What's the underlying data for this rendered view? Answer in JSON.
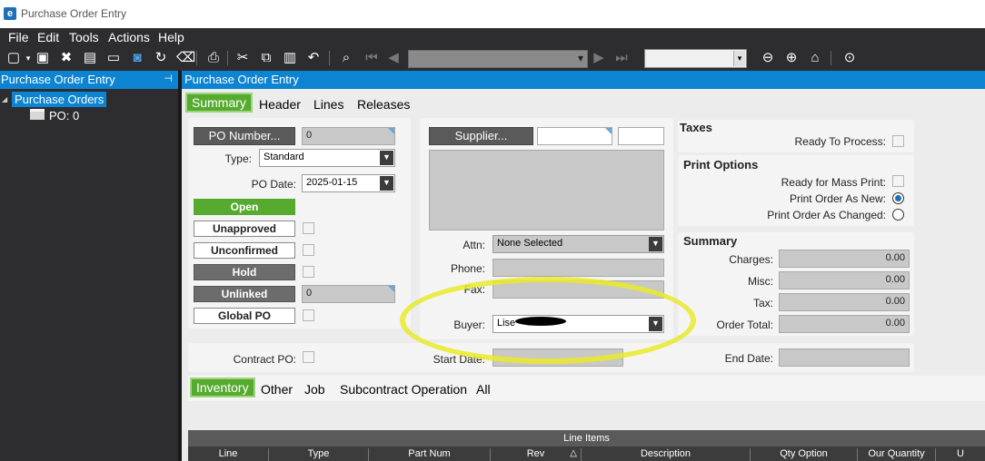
{
  "window": {
    "title": "Purchase Order Entry",
    "app_icon": "epicor-icon"
  },
  "menu": [
    "File",
    "Edit",
    "Tools",
    "Actions",
    "Help"
  ],
  "tree": {
    "header": "Purchase Order Entry",
    "root": "Purchase Orders",
    "child": "PO: 0"
  },
  "main": {
    "header": "Purchase Order Entry",
    "tabs": [
      "Summary",
      "Header",
      "Lines",
      "Releases"
    ],
    "po_number_button": "PO Number...",
    "po_number_value": "0",
    "type_label": "Type:",
    "type_value": "Standard",
    "po_date_label": "PO Date:",
    "po_date_value": "2025-01-15",
    "status": {
      "open": "Open",
      "unapproved": "Unapproved",
      "unconfirmed": "Unconfirmed",
      "hold": "Hold",
      "unlinked": "Unlinked",
      "unlinked_value": "0",
      "global_po": "Global PO"
    },
    "supplier_button": "Supplier...",
    "attn_label": "Attn:",
    "attn_value": "None Selected",
    "phone_label": "Phone:",
    "fax_label": "Fax:",
    "buyer_label": "Buyer:",
    "buyer_value": "Lise",
    "taxes": {
      "title": "Taxes",
      "ready_to_process": "Ready To Process:"
    },
    "print_options": {
      "title": "Print Options",
      "ready_mass_print": "Ready for Mass Print:",
      "print_as_new": "Print Order As New:",
      "print_as_changed": "Print Order As Changed:"
    },
    "summary": {
      "title": "Summary",
      "charges_label": "Charges:",
      "charges": "0.00",
      "misc_label": "Misc:",
      "misc": "0.00",
      "tax_label": "Tax:",
      "tax": "0.00",
      "order_total_label": "Order Total:",
      "order_total": "0.00"
    },
    "contract_po_label": "Contract PO:",
    "start_date_label": "Start Date:",
    "end_date_label": "End Date:",
    "sub_tabs": [
      "Inventory",
      "Other",
      "Job",
      "Subcontract Operation",
      "All"
    ],
    "grid": {
      "caption": "Line Items",
      "columns": [
        "Line",
        "Type",
        "Part Num",
        "Rev",
        "Description",
        "Qty Option",
        "Our Quantity",
        "U"
      ]
    }
  }
}
